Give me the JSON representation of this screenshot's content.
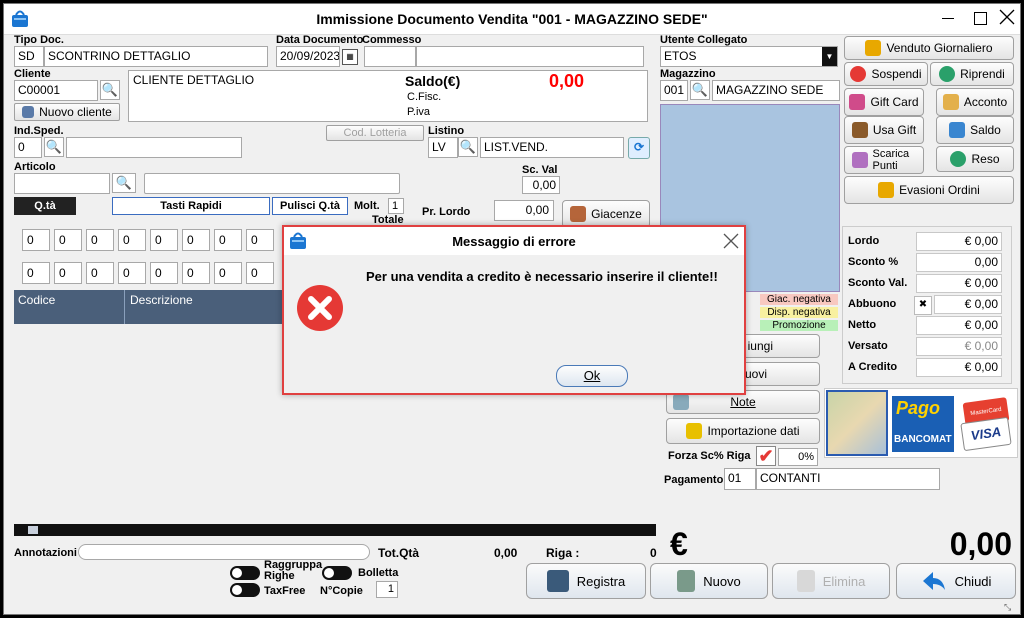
{
  "window": {
    "title": "Immissione Documento Vendita \"001 - MAGAZZINO SEDE\""
  },
  "doc": {
    "tipo_label": "Tipo Doc.",
    "tipo_code": "SD",
    "tipo_desc": "SCONTRINO DETTAGLIO",
    "data_label": "Data Documento",
    "data_value": "20/09/2023",
    "commesso_label": "Commesso"
  },
  "cliente": {
    "label": "Cliente",
    "code": "C00001",
    "name": "CLIENTE DETTAGLIO",
    "new_button": "Nuovo cliente",
    "saldo_label": "Saldo(€)",
    "saldo_value": "0,00",
    "cfisc_label": "C.Fisc.",
    "piva_label": "P.iva"
  },
  "indsped": {
    "label": "Ind.Sped.",
    "value": "0"
  },
  "lotteria": {
    "button": "Cod. Lotteria"
  },
  "listino": {
    "label": "Listino",
    "code": "LV",
    "desc": "LIST.VEND."
  },
  "articolo": {
    "label": "Articolo",
    "scval_label": "Sc. Val",
    "scval_value": "0,00"
  },
  "tabs": {
    "qta": "Q.tà",
    "tasti_rapidi": "Tasti Rapidi",
    "pulisci": "Pulisci Q.tà"
  },
  "molt": {
    "label": "Molt.",
    "value": "1",
    "totale_label": "Totale"
  },
  "prlordo": {
    "label": "Pr. Lordo",
    "value": "0,00"
  },
  "giacenze_button": "Giacenze",
  "quick_qty_row1": [
    "0",
    "0",
    "0",
    "0",
    "0",
    "0",
    "0",
    "0"
  ],
  "quick_qty_row2": [
    "0",
    "0",
    "0",
    "0",
    "0",
    "0",
    "0",
    "0"
  ],
  "table": {
    "col_codice": "Codice",
    "col_descrizione": "Descrizione"
  },
  "utente": {
    "label": "Utente Collegato",
    "value": "ETOS"
  },
  "magazzino": {
    "label": "Magazzino",
    "code": "001",
    "desc": "MAGAZZINO SEDE"
  },
  "legend": {
    "giac": "Giac. negativa",
    "disp": "Disp. negativa",
    "promo": "Promozione"
  },
  "right_buttons": {
    "venduto": "Venduto Giornaliero",
    "sospendi": "Sospendi",
    "riprendi": "Riprendi",
    "giftcard": "Gift Card",
    "acconto": "Acconto",
    "usagift": "Usa Gift",
    "saldo": "Saldo",
    "scarica": "Scarica Punti",
    "reso": "Reso",
    "evasioni": "Evasioni Ordini"
  },
  "totals": [
    {
      "label": "Lordo",
      "value": "€ 0,00"
    },
    {
      "label": "Sconto %",
      "value": "0,00"
    },
    {
      "label": "Sconto Val.",
      "value": "€ 0,00"
    },
    {
      "label": "Abbuono",
      "value": "€ 0,00"
    },
    {
      "label": "Netto",
      "value": "€ 0,00"
    },
    {
      "label": "Versato",
      "value": "€ 0,00"
    },
    {
      "label": "A Credito",
      "value": "€ 0,00"
    }
  ],
  "mid_buttons": {
    "aggiungi": "iungi",
    "nuovi": "uovi",
    "note": "Note",
    "importazione": "Importazione dati"
  },
  "payment_logos": {
    "pago": "Pago",
    "bancomat": "BANCOMAT",
    "visa": "VISA",
    "mastercard": "MasterCard"
  },
  "forza": {
    "label": "Forza Sc% Riga",
    "value": "0%"
  },
  "pagamento": {
    "label": "Pagamento",
    "code": "01",
    "desc": "CONTANTI"
  },
  "bottom": {
    "annotazioni_label": "Annotazioni",
    "totqta_label": "Tot.Qtà",
    "totqta_value": "0,00",
    "riga_label": "Riga :",
    "riga_value": "0",
    "currency": "€",
    "grand_total": "0,00",
    "raggruppa": "Raggruppa Righe",
    "bolletta": "Bolletta",
    "taxfree": "TaxFree",
    "ncopie_label": "N°Copie",
    "ncopie_value": "1"
  },
  "actions": {
    "registra": "Registra",
    "nuovo": "Nuovo",
    "elimina": "Elimina",
    "chiudi": "Chiudi"
  },
  "dialog": {
    "title": "Messaggio di errore",
    "message": "Per una vendita a credito è necessario inserire il cliente!!",
    "ok": "Ok"
  },
  "colors": {
    "accent": "#1b76d2",
    "error": "#e53935",
    "saldo_red": "#ff0000"
  }
}
